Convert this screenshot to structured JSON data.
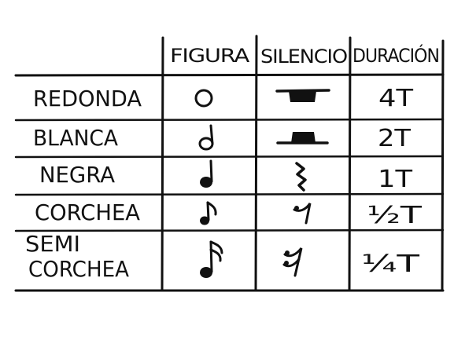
{
  "table": {
    "headers": {
      "figura": "FIGURA",
      "silencio": "SILENCIO",
      "duracion": "DURACIÓN"
    },
    "rows": [
      {
        "name": "REDONDA",
        "name_lines": [
          "REDONDA"
        ],
        "figure_icon": "whole-note-icon",
        "rest_icon": "whole-rest-icon",
        "duration": "4T"
      },
      {
        "name": "BLANCA",
        "name_lines": [
          "BLANCA"
        ],
        "figure_icon": "half-note-icon",
        "rest_icon": "half-rest-icon",
        "duration": "2T"
      },
      {
        "name": "NEGRA",
        "name_lines": [
          "NEGRA"
        ],
        "figure_icon": "quarter-note-icon",
        "rest_icon": "quarter-rest-icon",
        "duration": "1T"
      },
      {
        "name": "CORCHEA",
        "name_lines": [
          "CORCHEA"
        ],
        "figure_icon": "eighth-note-icon",
        "rest_icon": "eighth-rest-icon",
        "duration": "½T"
      },
      {
        "name": "SEMI CORCHEA",
        "name_lines": [
          "SEMI",
          "CORCHEA"
        ],
        "figure_icon": "sixteenth-note-icon",
        "rest_icon": "sixteenth-rest-icon",
        "duration": "¼T"
      }
    ]
  }
}
